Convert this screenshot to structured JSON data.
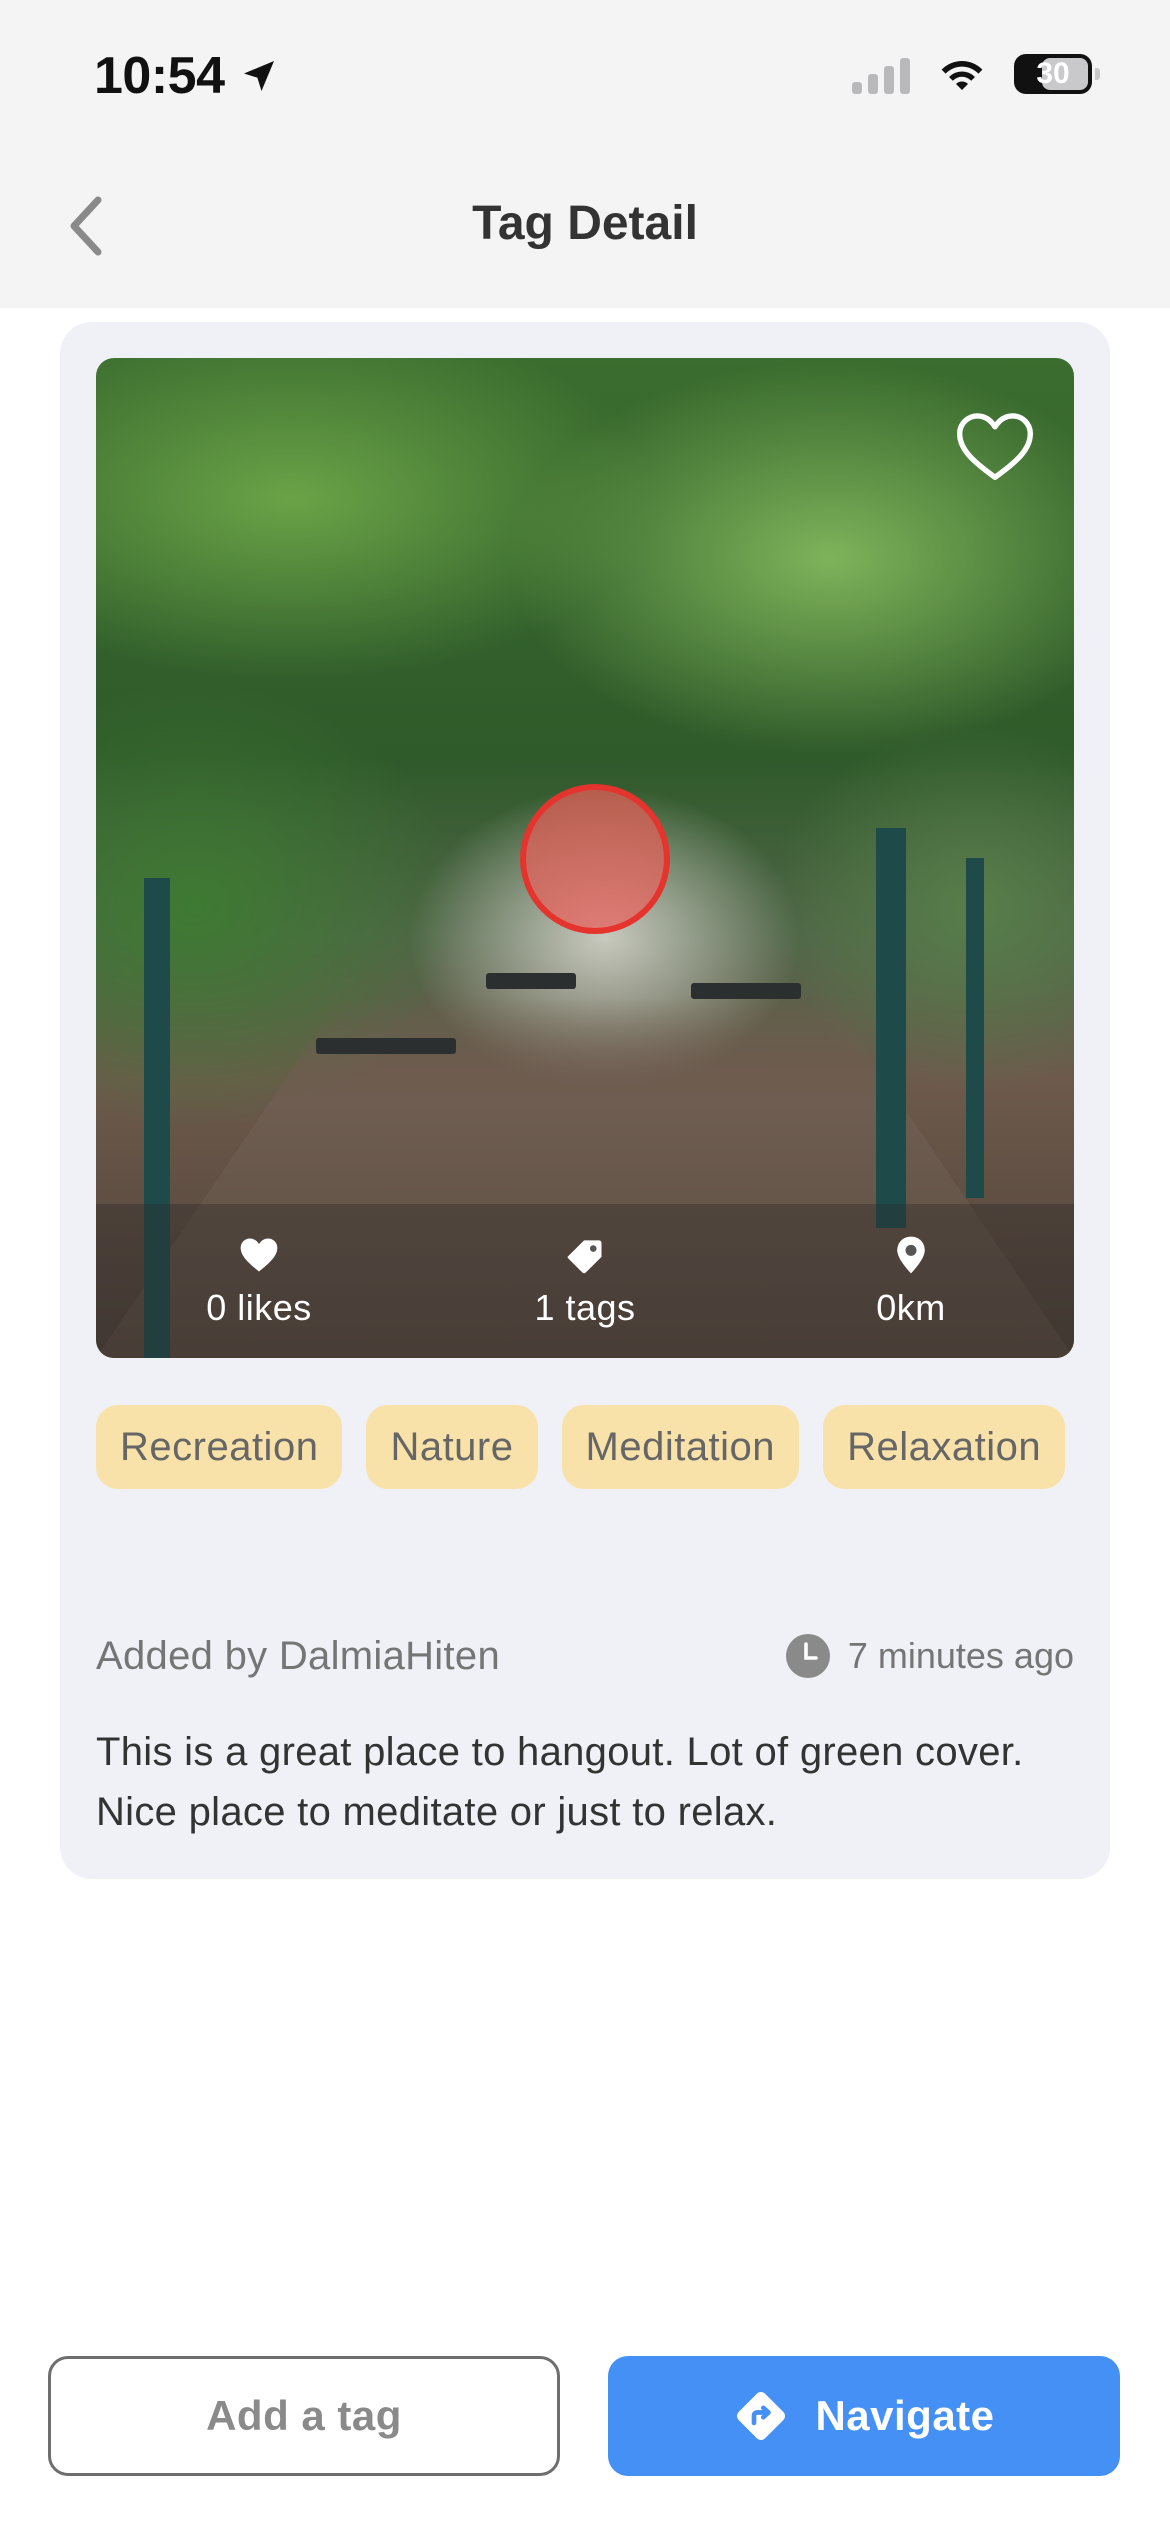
{
  "status_bar": {
    "time": "10:54",
    "battery": "30"
  },
  "header": {
    "title": "Tag Detail"
  },
  "card": {
    "stats": {
      "likes": "0 likes",
      "tags": "1 tags",
      "distance": "0km"
    },
    "chips": [
      "Recreation",
      "Nature",
      "Meditation",
      "Relaxation"
    ],
    "added_by": "Added by DalmiaHiten",
    "time_ago": "7 minutes ago",
    "description": "This is a great place to hangout. Lot of green cover. Nice place to meditate or just to relax."
  },
  "buttons": {
    "add_tag": "Add a tag",
    "navigate": "Navigate"
  },
  "colors": {
    "chip_bg": "#f8e2a9",
    "primary": "#4590f5",
    "marker": "#e5332d",
    "card_bg": "#f0f1f7"
  }
}
